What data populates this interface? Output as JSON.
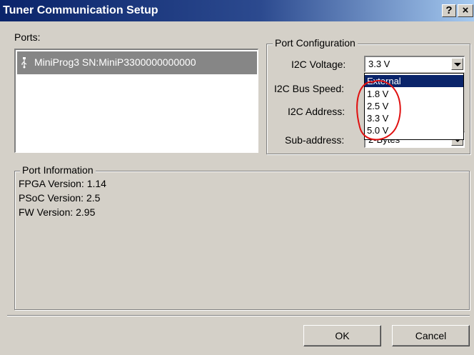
{
  "window": {
    "title": "Tuner Communication Setup",
    "help_label": "?",
    "close_label": "×"
  },
  "ports": {
    "label": "Ports:",
    "items": [
      {
        "label": "MiniProg3 SN:MiniP3300000000000",
        "selected": true
      }
    ]
  },
  "port_config": {
    "title": "Port Configuration",
    "voltage_label": "I2C Voltage:",
    "voltage_value": "3.3 V",
    "bus_speed_label": "I2C Bus Speed:",
    "address_label": "I2C Address:",
    "subaddress_label": "Sub-address:",
    "subaddress_value": "2-Bytes",
    "voltage_options": [
      "External",
      "1.8 V",
      "2.5 V",
      "3.3 V",
      "5.0 V"
    ],
    "highlighted_option": "External"
  },
  "port_info": {
    "title": "Port Information",
    "lines": [
      "FPGA Version: 1.14",
      "PSoC Version: 2.5",
      "FW Version: 2.95"
    ]
  },
  "buttons": {
    "ok": "OK",
    "cancel": "Cancel"
  },
  "colors": {
    "title_bar": "#0a246a",
    "dialog_face": "#d4d0c8",
    "selection": "#868686",
    "annotation": "#e01010"
  }
}
